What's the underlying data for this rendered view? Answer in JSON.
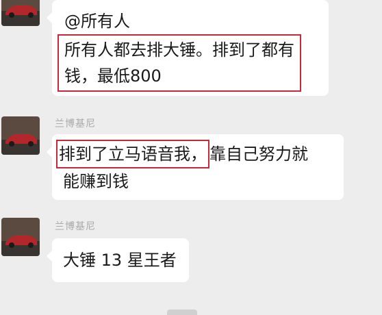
{
  "messages": [
    {
      "sender": "",
      "mention": "@所有人",
      "lines": [
        "所有人都去排大锤。排到了都有",
        "钱，最低800"
      ]
    },
    {
      "sender": "兰博基尼",
      "highlight": "排到了立马语音我，",
      "rest_line1": "靠自己努力就",
      "line2": "能赚到钱"
    },
    {
      "sender": "兰博基尼",
      "text": "大锤 13 星王者"
    }
  ],
  "avatar": {
    "icon": "red-car-avatar",
    "color": "#b3262a"
  }
}
